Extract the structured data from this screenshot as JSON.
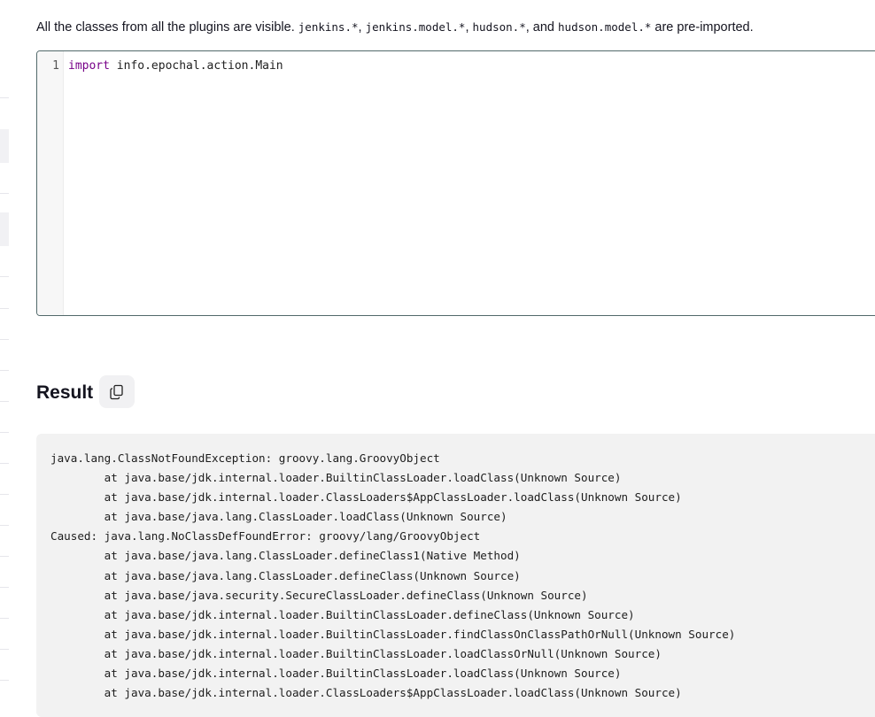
{
  "description": {
    "prefix": "All the classes from all the plugins are visible. ",
    "code1": "jenkins.*",
    "sep1": ", ",
    "code2": "jenkins.model.*",
    "sep2": ", ",
    "code3": "hudson.*",
    "sep3": ", and ",
    "code4": "hudson.model.*",
    "suffix": " are pre-imported."
  },
  "editor": {
    "line_number": "1",
    "keyword": "import",
    "code": " info.epochal.action.Main"
  },
  "result": {
    "heading": "Result",
    "copy_icon": "copy-icon",
    "lines": [
      "java.lang.ClassNotFoundException: groovy.lang.GroovyObject",
      "        at java.base/jdk.internal.loader.BuiltinClassLoader.loadClass(Unknown Source)",
      "        at java.base/jdk.internal.loader.ClassLoaders$AppClassLoader.loadClass(Unknown Source)",
      "        at java.base/java.lang.ClassLoader.loadClass(Unknown Source)",
      "Caused: java.lang.NoClassDefFoundError: groovy/lang/GroovyObject",
      "        at java.base/java.lang.ClassLoader.defineClass1(Native Method)",
      "        at java.base/java.lang.ClassLoader.defineClass(Unknown Source)",
      "        at java.base/java.security.SecureClassLoader.defineClass(Unknown Source)",
      "        at java.base/jdk.internal.loader.BuiltinClassLoader.defineClass(Unknown Source)",
      "        at java.base/jdk.internal.loader.BuiltinClassLoader.findClassOnClassPathOrNull(Unknown Source)",
      "        at java.base/jdk.internal.loader.BuiltinClassLoader.loadClassOrNull(Unknown Source)",
      "        at java.base/jdk.internal.loader.BuiltinClassLoader.loadClass(Unknown Source)",
      "        at java.base/jdk.internal.loader.ClassLoaders$AppClassLoader.loadClass(Unknown Source)"
    ]
  },
  "colors": {
    "editor_border": "#52696a",
    "keyword": "#770088",
    "output_background": "#f2f2f2"
  }
}
